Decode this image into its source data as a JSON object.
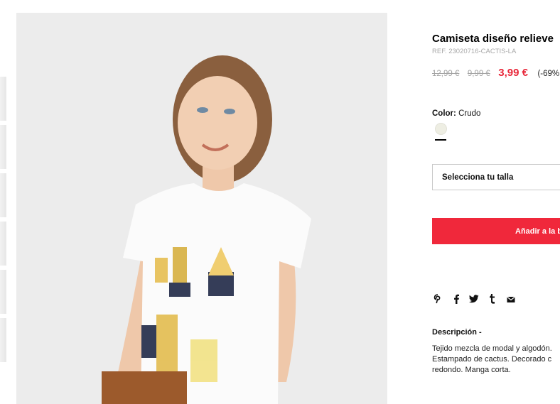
{
  "product": {
    "title": "Camiseta diseño relieve",
    "ref": "REF. 23020716-CACTIS-LA",
    "prices": {
      "original": "12,99 €",
      "previous": "9,99 €",
      "current": "3,99 €",
      "discount": "(-69%"
    }
  },
  "color": {
    "label": "Color:",
    "value": "Crudo",
    "swatch_hex": "#eeeee3"
  },
  "size_select": {
    "label": "Selecciona tu talla"
  },
  "add_to_cart": {
    "label": "Añadir a la b"
  },
  "share_icons": [
    "pinterest-icon",
    "facebook-icon",
    "twitter-icon",
    "tumblr-icon",
    "email-icon"
  ],
  "description": {
    "title": "Descripción -",
    "lines": [
      "Tejido mezcla de modal y algodón.",
      "Estampado de cactus. Decorado c",
      "redondo. Manga corta."
    ]
  },
  "colors": {
    "accent_red": "#f0283b",
    "price_red": "#e8283a"
  }
}
